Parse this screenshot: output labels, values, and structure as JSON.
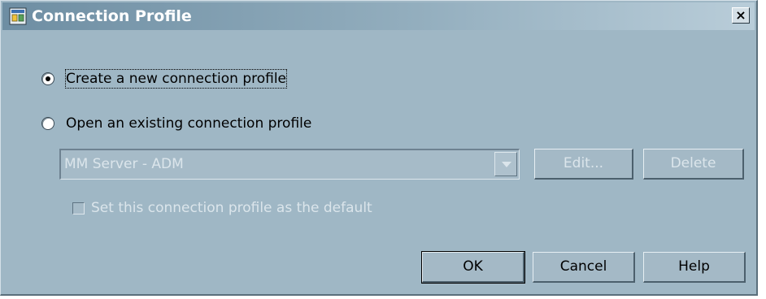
{
  "dialog": {
    "title": "Connection Profile",
    "close_label": "×",
    "title_icon": "window-app-icon"
  },
  "options": {
    "create_label": "Create a new connection profile",
    "create_selected": true,
    "open_label": "Open an existing connection profile",
    "open_selected": false
  },
  "profile_select": {
    "value": "MM Server - ADM",
    "enabled": false
  },
  "buttons": {
    "edit_label": "Edit...",
    "delete_label": "Delete",
    "ok_label": "OK",
    "cancel_label": "Cancel",
    "help_label": "Help"
  },
  "default_checkbox": {
    "label": "Set this connection profile as the default",
    "checked": false,
    "enabled": false
  },
  "colors": {
    "dialog_bg": "#9fb7c5",
    "title_gradient_start": "#6e8ea3",
    "disabled_text": "#dbe5eb"
  }
}
